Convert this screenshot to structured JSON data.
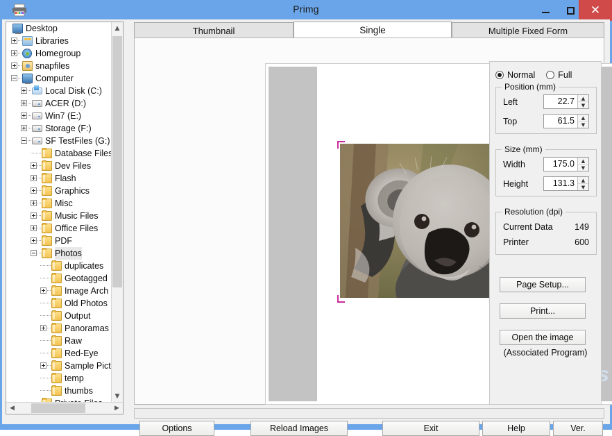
{
  "window": {
    "title": "Primg",
    "icon": "printer-icon",
    "minimize_label": "–",
    "maximize_label": "□",
    "close_label": "✕",
    "close_color": "#d04a4a",
    "titlebar_color": "#6aa5e9"
  },
  "tree": {
    "items": [
      {
        "label": "Desktop",
        "depth": 0,
        "icon": "monitor-icon",
        "expander": "none",
        "selected": false
      },
      {
        "label": "Libraries",
        "depth": 1,
        "icon": "libraries-icon",
        "expander": "plus",
        "selected": false
      },
      {
        "label": "Homegroup",
        "depth": 1,
        "icon": "homegroup-icon",
        "expander": "plus",
        "selected": false
      },
      {
        "label": "snapfiles",
        "depth": 1,
        "icon": "user-icon",
        "expander": "plus",
        "selected": false
      },
      {
        "label": "Computer",
        "depth": 1,
        "icon": "computer-icon",
        "expander": "minus",
        "selected": false
      },
      {
        "label": "Local Disk (C:)",
        "depth": 2,
        "icon": "disk-icon",
        "expander": "plus",
        "selected": false
      },
      {
        "label": "ACER (D:)",
        "depth": 2,
        "icon": "drive-icon",
        "expander": "plus",
        "selected": false
      },
      {
        "label": "Win7 (E:)",
        "depth": 2,
        "icon": "drive-icon",
        "expander": "plus",
        "selected": false
      },
      {
        "label": "Storage (F:)",
        "depth": 2,
        "icon": "drive-icon",
        "expander": "plus",
        "selected": false
      },
      {
        "label": "SF TestFiles (G:)",
        "depth": 2,
        "icon": "drive-icon",
        "expander": "minus",
        "selected": false
      },
      {
        "label": "Database Files",
        "depth": 3,
        "icon": "folder-icon",
        "expander": "none",
        "selected": false
      },
      {
        "label": "Dev Files",
        "depth": 3,
        "icon": "folder-icon",
        "expander": "plus",
        "selected": false
      },
      {
        "label": "Flash",
        "depth": 3,
        "icon": "folder-icon",
        "expander": "plus",
        "selected": false
      },
      {
        "label": "Graphics",
        "depth": 3,
        "icon": "folder-icon",
        "expander": "plus",
        "selected": false
      },
      {
        "label": "Misc",
        "depth": 3,
        "icon": "folder-icon",
        "expander": "plus",
        "selected": false
      },
      {
        "label": "Music Files",
        "depth": 3,
        "icon": "folder-icon",
        "expander": "plus",
        "selected": false
      },
      {
        "label": "Office Files",
        "depth": 3,
        "icon": "folder-icon",
        "expander": "plus",
        "selected": false
      },
      {
        "label": "PDF",
        "depth": 3,
        "icon": "folder-icon",
        "expander": "plus",
        "selected": false
      },
      {
        "label": "Photos",
        "depth": 3,
        "icon": "folder-icon",
        "expander": "minus",
        "selected": true
      },
      {
        "label": "duplicates",
        "depth": 4,
        "icon": "folder-icon",
        "expander": "none",
        "selected": false
      },
      {
        "label": "Geotagged",
        "depth": 4,
        "icon": "folder-icon",
        "expander": "none",
        "selected": false
      },
      {
        "label": "Image Arch",
        "depth": 4,
        "icon": "folder-icon",
        "expander": "plus",
        "selected": false
      },
      {
        "label": "Old Photos",
        "depth": 4,
        "icon": "folder-icon",
        "expander": "none",
        "selected": false
      },
      {
        "label": "Output",
        "depth": 4,
        "icon": "folder-icon",
        "expander": "none",
        "selected": false
      },
      {
        "label": "Panoramas",
        "depth": 4,
        "icon": "folder-icon",
        "expander": "plus",
        "selected": false
      },
      {
        "label": "Raw",
        "depth": 4,
        "icon": "folder-icon",
        "expander": "none",
        "selected": false
      },
      {
        "label": "Red-Eye",
        "depth": 4,
        "icon": "folder-icon",
        "expander": "none",
        "selected": false
      },
      {
        "label": "Sample Pict",
        "depth": 4,
        "icon": "folder-icon",
        "expander": "plus",
        "selected": false
      },
      {
        "label": "temp",
        "depth": 4,
        "icon": "folder-icon",
        "expander": "none",
        "selected": false
      },
      {
        "label": "thumbs",
        "depth": 4,
        "icon": "folder-icon",
        "expander": "none",
        "selected": false
      },
      {
        "label": "Private Files",
        "depth": 3,
        "icon": "folder-icon",
        "expander": "none",
        "selected": false
      }
    ],
    "scroll_up_glyph": "▲",
    "scroll_down_glyph": "▼",
    "scroll_left_glyph": "◀",
    "scroll_right_glyph": "▶"
  },
  "tabs": [
    {
      "label": "Thumbnail",
      "active": false
    },
    {
      "label": "Single",
      "active": true
    },
    {
      "label": "Multiple Fixed Form",
      "active": false
    }
  ],
  "preview": {
    "image_subject": "koala",
    "handle_color": "#cc2a9b",
    "page_color": "#ffffff",
    "band_color": "#c3c3c3",
    "watermark_mark": "S",
    "watermark_text": "SnapFiles"
  },
  "settings": {
    "mode": {
      "normal_label": "Normal",
      "full_label": "Full",
      "selected": "Normal"
    },
    "position": {
      "title": "Position (mm)",
      "fields": [
        {
          "label": "Left",
          "value": "22.7"
        },
        {
          "label": "Top",
          "value": "61.5"
        }
      ]
    },
    "size": {
      "title": "Size (mm)",
      "fields": [
        {
          "label": "Width",
          "value": "175.0"
        },
        {
          "label": "Height",
          "value": "131.3"
        }
      ]
    },
    "resolution": {
      "title": "Resolution (dpi)",
      "rows": [
        {
          "label": "Current Data",
          "value": "149"
        },
        {
          "label": "Printer",
          "value": "600"
        }
      ]
    },
    "buttons": {
      "page_setup": "Page Setup...",
      "print": "Print...",
      "open_image": "Open the image"
    },
    "associated_note": "(Associated Program)",
    "spin_up_glyph": "▲",
    "spin_down_glyph": "▼"
  },
  "bottom_buttons": [
    {
      "label": "Options"
    },
    {
      "label": "Reload Images"
    },
    {
      "label": "Exit"
    },
    {
      "label": "Help"
    },
    {
      "label": "Ver."
    }
  ]
}
